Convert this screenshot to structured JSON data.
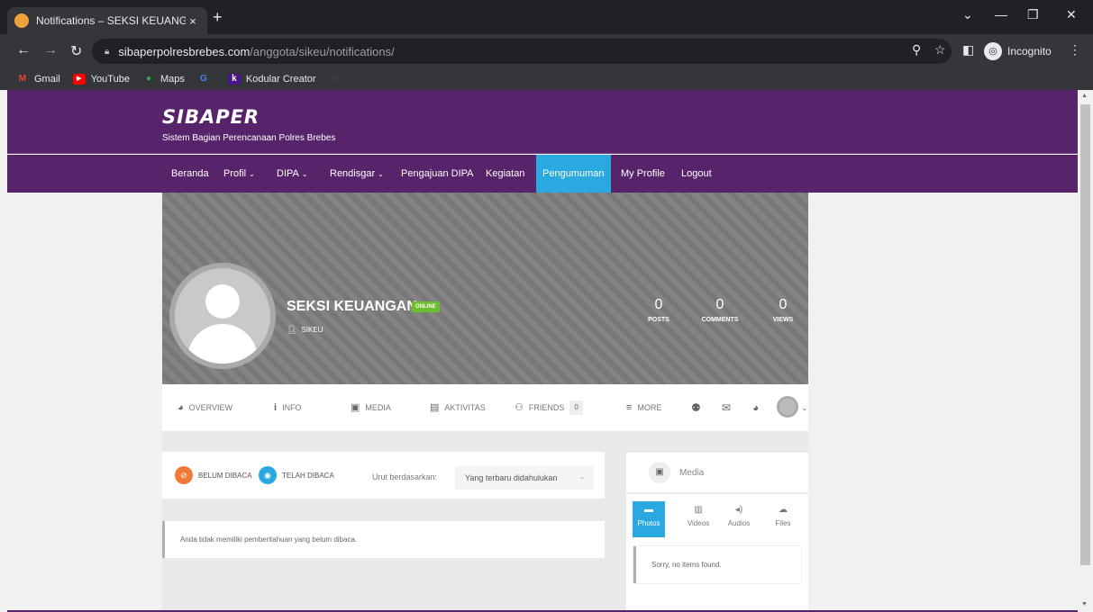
{
  "browser": {
    "tab_title": "Notifications – SEKSI KEUANGAN",
    "tab_close": "×",
    "new_tab": "+",
    "url_host": "sibaperpolresbrebes.com",
    "url_path": "/anggota/sikeu/notifications/",
    "incognito_label": "Incognito",
    "bookmarks": [
      {
        "label": "Gmail",
        "icon": "gmail-icon",
        "color": "#ea4335"
      },
      {
        "label": "YouTube",
        "icon": "youtube-icon",
        "color": "#ff0000"
      },
      {
        "label": "Maps",
        "icon": "maps-icon",
        "color": "#34a853"
      },
      {
        "label": "",
        "icon": "google-icon",
        "color": "#4285f4"
      },
      {
        "label": "Kodular Creator",
        "icon": "kodular-icon",
        "color": "#6a1b9a"
      }
    ]
  },
  "site": {
    "logo": "SIBAPER",
    "tagline": "Sistem Bagian Perencanaan Polres Brebes",
    "brand_color": "#57236a",
    "accent_color": "#2aa9e0"
  },
  "nav": {
    "items": [
      {
        "label": "Beranda"
      },
      {
        "label": "Profil"
      },
      {
        "label": "DIPA"
      },
      {
        "label": "Rendisgar"
      },
      {
        "label": "Pengajuan DIPA"
      },
      {
        "label": "Kegiatan"
      },
      {
        "label": "Pengumuman"
      },
      {
        "label": "My Profile"
      },
      {
        "label": "Logout"
      }
    ]
  },
  "profile": {
    "name": "SEKSI KEUANGAN",
    "status": "ONLINE",
    "username": "SIKEU",
    "stats": [
      {
        "value": "0",
        "label": "POSTS"
      },
      {
        "value": "0",
        "label": "COMMENTS"
      },
      {
        "value": "0",
        "label": "VIEWS"
      }
    ]
  },
  "profile_nav": {
    "overview": "OVERVIEW",
    "info": "INFO",
    "media": "MEDIA",
    "activity": "AKTIVITAS",
    "friends": "FRIENDS",
    "friends_count": "0",
    "more": "MORE"
  },
  "notifications": {
    "unread_label": "BELUM DIBACA",
    "read_label": "TELAH DIBACA",
    "sort_label": "Urut berdasarkan:",
    "sort_value": "Yang terbaru didahulukan",
    "empty_message": "Anda tidak memiliki pemberitahuan yang belum dibaca."
  },
  "media_widget": {
    "title": "Media",
    "tabs": [
      {
        "label": "Photos",
        "icon": "photo-icon"
      },
      {
        "label": "Videos",
        "icon": "film-icon"
      },
      {
        "label": "Audios",
        "icon": "speaker-icon"
      },
      {
        "label": "Files",
        "icon": "cloud-icon"
      }
    ],
    "empty_message": "Sorry, no items found."
  }
}
